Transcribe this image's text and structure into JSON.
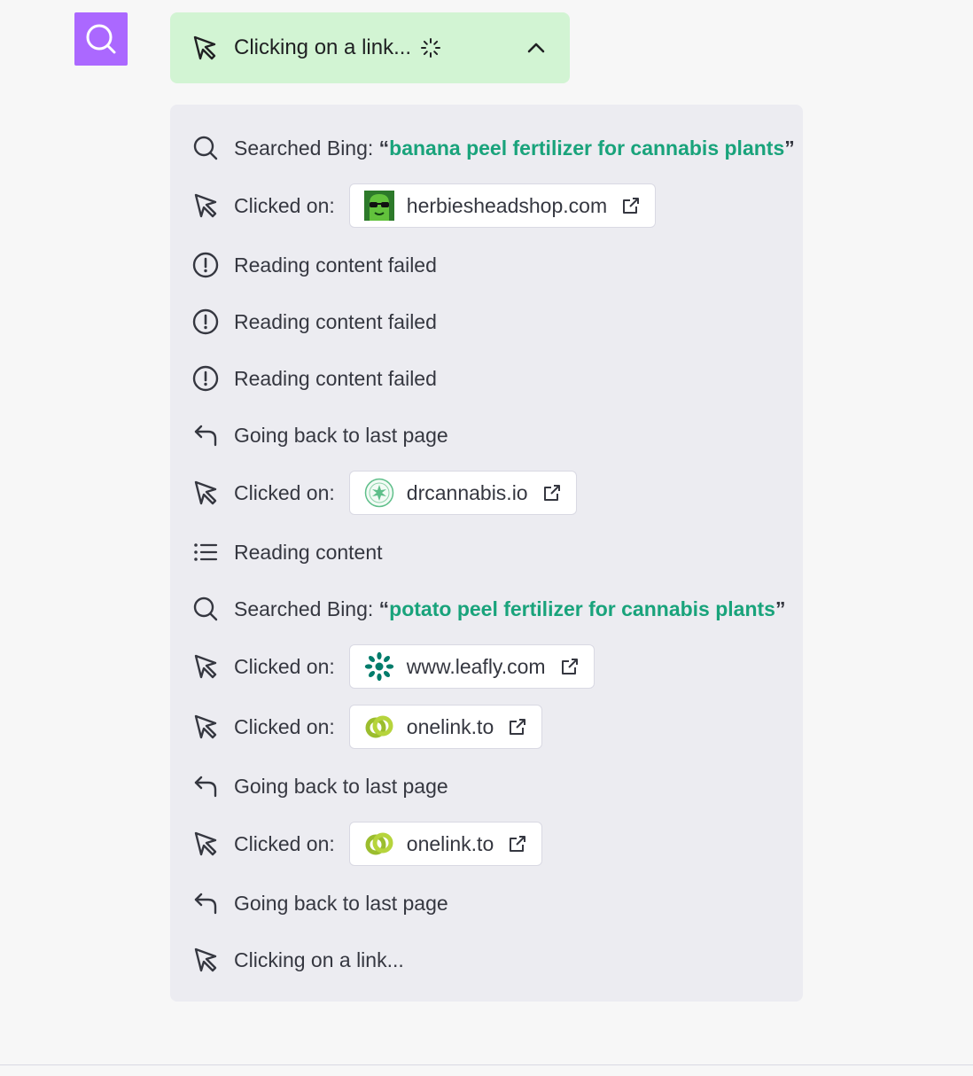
{
  "status": {
    "label": "Clicking on a link..."
  },
  "steps": [
    {
      "type": "search",
      "prefix": "Searched Bing: ",
      "open_quote": "“",
      "query": "banana peel fertilizer for cannabis plants",
      "close_quote": "”"
    },
    {
      "type": "click",
      "prefix": "Clicked on:",
      "site": "herbiesheadshop.com"
    },
    {
      "type": "error",
      "label": "Reading content failed"
    },
    {
      "type": "error",
      "label": "Reading content failed"
    },
    {
      "type": "error",
      "label": "Reading content failed"
    },
    {
      "type": "back",
      "label": "Going back to last page"
    },
    {
      "type": "click",
      "prefix": "Clicked on:",
      "site": "drcannabis.io"
    },
    {
      "type": "read",
      "label": "Reading content"
    },
    {
      "type": "search",
      "prefix": "Searched Bing: ",
      "open_quote": "“",
      "query": "potato peel fertilizer for cannabis plants",
      "close_quote": "”"
    },
    {
      "type": "click",
      "prefix": "Clicked on:",
      "site": "www.leafly.com"
    },
    {
      "type": "click",
      "prefix": "Clicked on:",
      "site": "onelink.to"
    },
    {
      "type": "back",
      "label": "Going back to last page"
    },
    {
      "type": "click",
      "prefix": "Clicked on:",
      "site": "onelink.to"
    },
    {
      "type": "back",
      "label": "Going back to last page"
    },
    {
      "type": "pending",
      "label": "Clicking on a link..."
    }
  ],
  "colors": {
    "avatar_bg": "#ab68ff",
    "status_bg": "#d2f4d3",
    "panel_bg": "#ececf1",
    "query_accent": "#19a37b"
  },
  "icons": {
    "avatar": "search-icon",
    "status": "cursor-icon",
    "spinner": "spinner-icon",
    "toggle": "chevron-up-icon"
  }
}
